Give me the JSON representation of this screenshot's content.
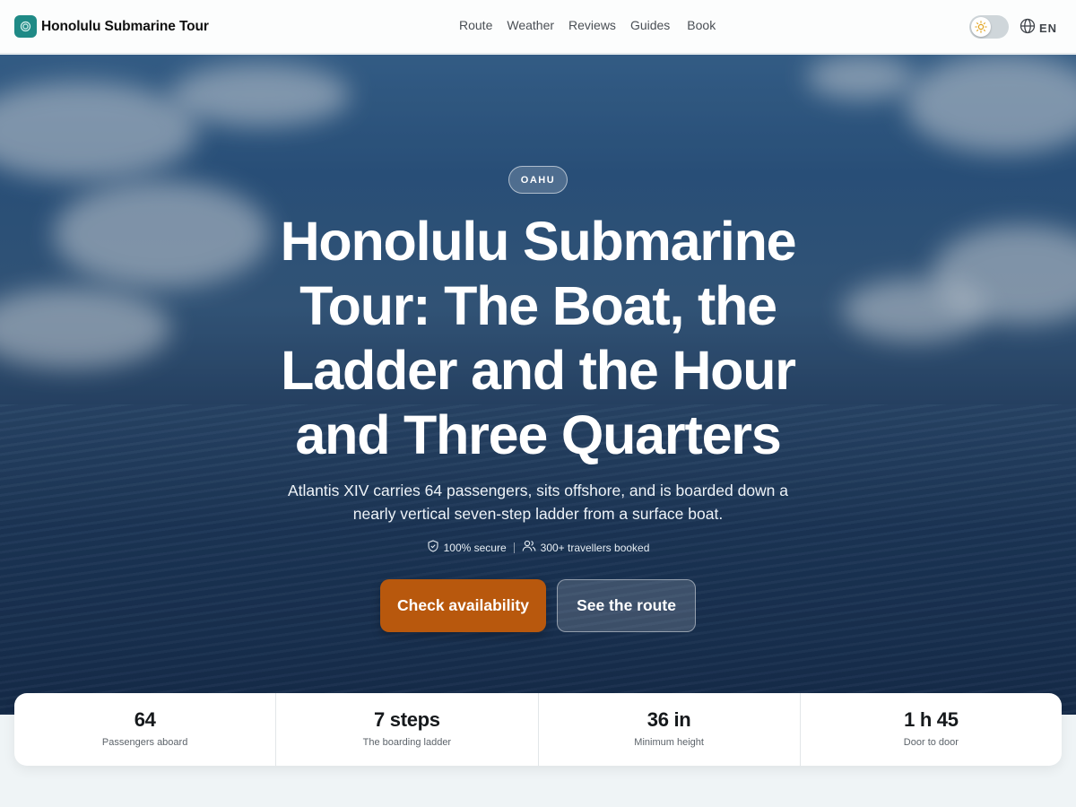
{
  "brand": {
    "name": "Honolulu Submarine Tour",
    "logo_icon": "spiral-icon",
    "logo_color": "#1f8a86"
  },
  "nav": {
    "items": [
      "Route",
      "Weather",
      "Reviews",
      "Guides",
      "Book"
    ]
  },
  "header": {
    "theme_toggle_icon": "sun-icon",
    "language_icon": "globe-icon",
    "language": "EN"
  },
  "hero": {
    "tag": "OAHU",
    "title": "Honolulu Submarine Tour: The Boat, the Ladder and the Hour and Three Quarters",
    "subtitle": "Atlantis XIV carries 64 passengers, sits offshore, and is boarded down a nearly vertical seven-step ladder from a surface boat.",
    "trust": [
      {
        "icon": "shield-check-icon",
        "text": "100% secure"
      },
      {
        "icon": "users-icon",
        "text": "300+ travellers booked"
      }
    ],
    "primary_cta": "Check availability",
    "secondary_cta": "See the route",
    "accent_color": "#b8580d"
  },
  "stats": [
    {
      "value": "64",
      "label": "Passengers aboard"
    },
    {
      "value": "7 steps",
      "label": "The boarding ladder"
    },
    {
      "value": "36 in",
      "label": "Minimum height"
    },
    {
      "value": "1 h 45",
      "label": "Door to door"
    }
  ]
}
